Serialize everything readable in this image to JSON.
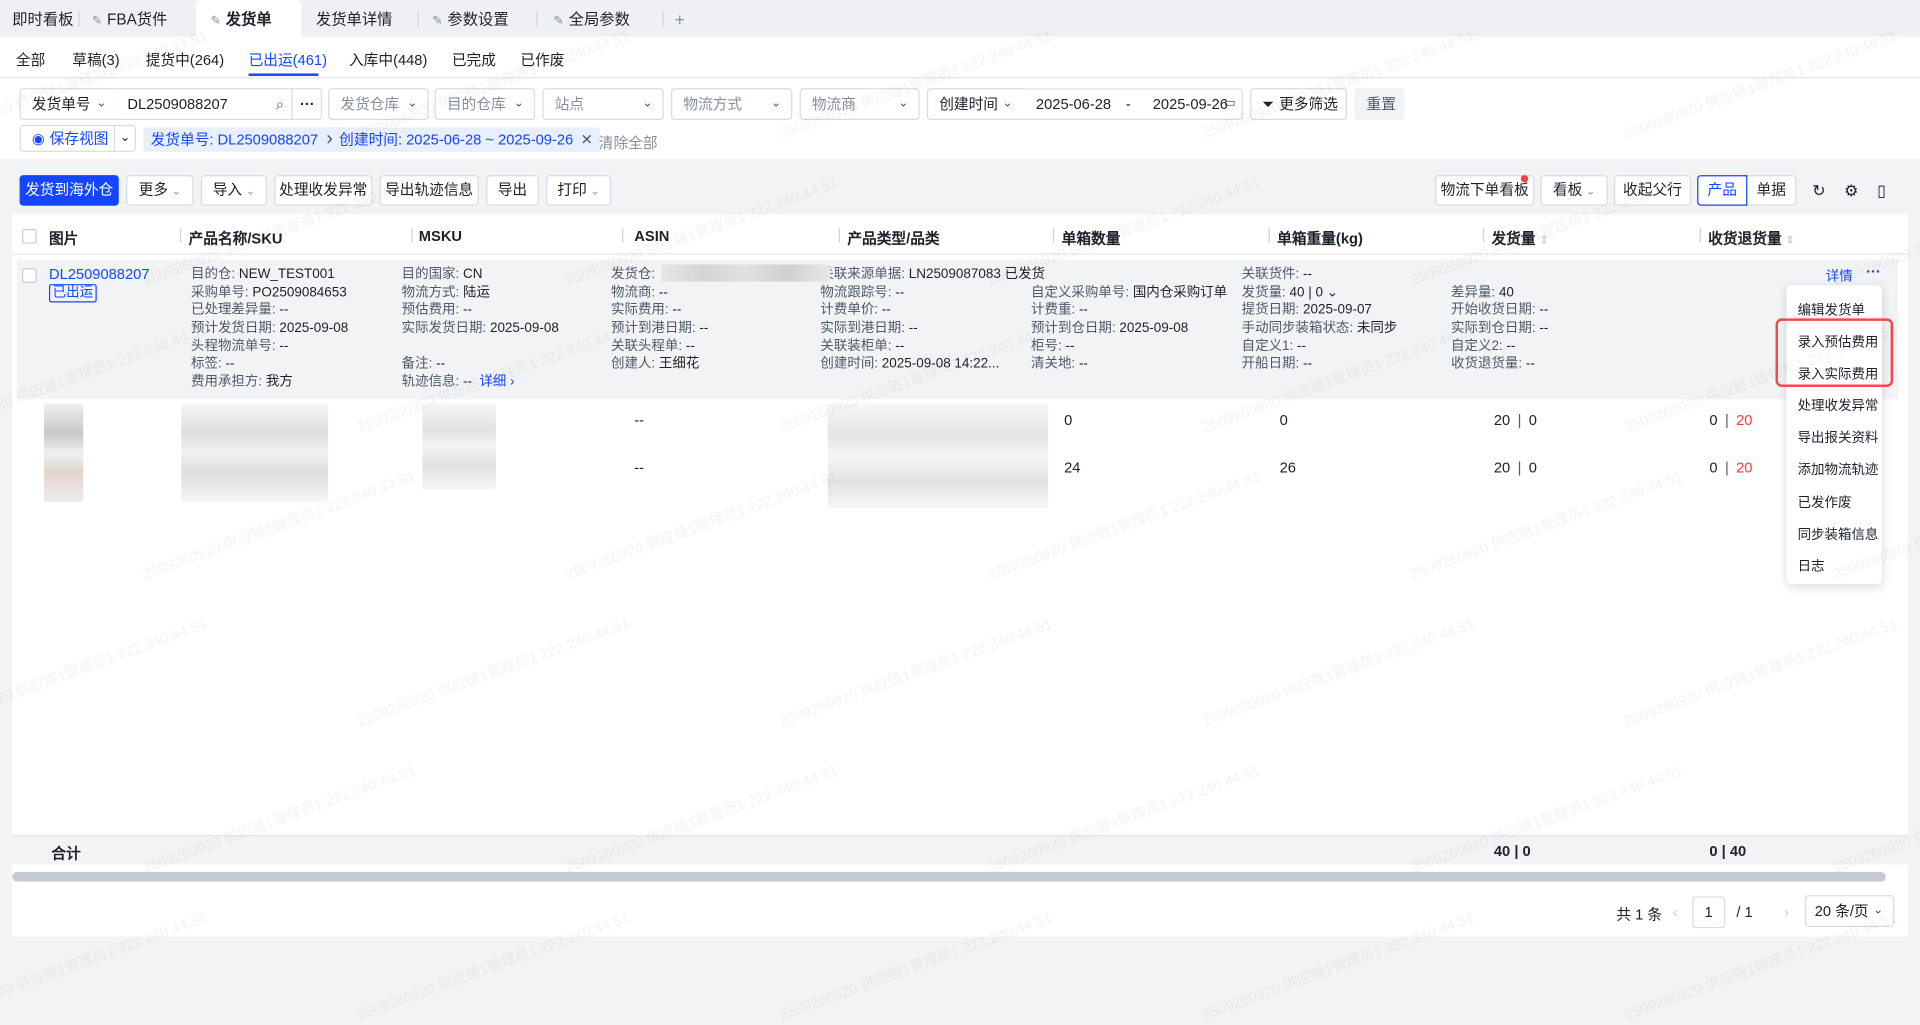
{
  "top_tabs": [
    {
      "label": "即时看板",
      "pinned": false
    },
    {
      "label": "FBA货件",
      "pinned": true
    },
    {
      "label": "发货单",
      "pinned": true,
      "active": true
    },
    {
      "label": "发货单详情",
      "pinned": false
    },
    {
      "label": "参数设置",
      "pinned": true
    },
    {
      "label": "全局参数",
      "pinned": true
    }
  ],
  "add_tab": "+",
  "status_tabs": [
    "全部",
    "草稿(3)",
    "提货中(264)",
    "已出运(461)",
    "入库中(448)",
    "已完成",
    "已作废"
  ],
  "active_status_tab": "已出运(461)",
  "filters": {
    "search_field": "发货单号",
    "search_value": "DL2509088207",
    "more_icon": "···",
    "ship_warehouse": "发货仓库",
    "dest_warehouse": "目的仓库",
    "site": "站点",
    "logistics_method": "物流方式",
    "carrier": "物流商",
    "date_field": "创建时间",
    "date_start": "2025-06-28",
    "date_sep": "-",
    "date_end": "2025-09-26",
    "more_filters": "更多筛选",
    "reset": "重置",
    "save_view": "保存视图",
    "chips": [
      "发货单号: DL2509088207",
      "创建时间: 2025-06-28 ~ 2025-09-26"
    ],
    "clear_all": "清除全部"
  },
  "toolbar": {
    "ship_overseas": "发货到海外仓",
    "more": "更多",
    "import": "导入",
    "handle_exception": "处理收发异常",
    "export_track": "导出轨迹信息",
    "export": "导出",
    "print": "打印",
    "logistics_board": "物流下单看板",
    "board": "看板",
    "collapse_parent": "收起父行",
    "view_product": "产品",
    "view_document": "单据"
  },
  "columns": [
    "图片",
    "产品名称/SKU",
    "MSKU",
    "ASIN",
    "产品类型/品类",
    "单箱数量",
    "单箱重量(kg)",
    "发货量",
    "收货退货量"
  ],
  "parent_row": {
    "order_no": "DL2509088207",
    "status": "已出运",
    "detail_link": "详情",
    "more": "···",
    "detail_columns": [
      [
        [
          "目的仓: ",
          "NEW_TEST001"
        ],
        [
          "采购单号: ",
          "PO2509084653"
        ],
        [
          "已处理差异量: ",
          "--"
        ],
        [
          "预计发货日期: ",
          "2025-09-08"
        ],
        [
          "头程物流单号: ",
          "--"
        ],
        [
          "标签: ",
          "--"
        ],
        [
          "费用承担方: ",
          "我方"
        ]
      ],
      [
        [
          "目的国家: ",
          "CN"
        ],
        [
          "物流方式: ",
          "陆运"
        ],
        [
          "预估费用: ",
          "--"
        ],
        [
          "实际发货日期: ",
          "2025-09-08"
        ],
        [
          "",
          ""
        ],
        [
          "备注: ",
          "--"
        ],
        [
          "轨迹信息: ",
          "--"
        ]
      ],
      [
        [
          "发货仓: ",
          ""
        ],
        [
          "物流商: ",
          "--"
        ],
        [
          "实际费用: ",
          "--"
        ],
        [
          "预计到港日期: ",
          "--"
        ],
        [
          "关联头程单: ",
          "--"
        ],
        [
          "创建人: ",
          "王细花"
        ]
      ],
      [
        [
          "关联来源单据: ",
          "LN2509087083 已发货"
        ],
        [
          "物流跟踪号: ",
          "--"
        ],
        [
          "计费单价: ",
          "--"
        ],
        [
          "实际到港日期: ",
          "--"
        ],
        [
          "关联装柜单: ",
          "--"
        ],
        [
          "创建时间: ",
          "2025-09-08 14:22..."
        ]
      ],
      [
        [
          "",
          ""
        ],
        [
          "自定义采购单号: ",
          "国内仓采购订单"
        ],
        [
          "计费重: ",
          "--"
        ],
        [
          "预计到仓日期: ",
          "2025-09-08"
        ],
        [
          "柜号: ",
          "--"
        ],
        [
          "清关地: ",
          "--"
        ]
      ],
      [
        [
          "关联货件: ",
          "--"
        ],
        [
          "发货量: ",
          "40 | 0 ⌄"
        ],
        [
          "提货日期: ",
          "2025-09-07"
        ],
        [
          "手动同步装箱状态: ",
          "未同步"
        ],
        [
          "自定义1: ",
          "--"
        ],
        [
          "开船日期: ",
          "--"
        ]
      ],
      [
        [
          "",
          ""
        ],
        [
          "差异量: ",
          "40"
        ],
        [
          "开始收货日期: ",
          "--"
        ],
        [
          "实际到仓日期: ",
          "--"
        ],
        [
          "自定义2: ",
          "--"
        ],
        [
          "收货退货量: ",
          "--"
        ]
      ]
    ],
    "track_detail_link": "详细 ›"
  },
  "child_rows": [
    {
      "asin": "--",
      "box_qty": "0",
      "box_weight": "0",
      "ship_qty": "20",
      "ship_qty2": "0",
      "recv_qty": "0",
      "return_qty": "20"
    },
    {
      "asin": "--",
      "box_qty": "24",
      "box_weight": "26",
      "ship_qty": "20",
      "ship_qty2": "0",
      "recv_qty": "0",
      "return_qty": "20"
    }
  ],
  "action_menu": [
    "编辑发货单",
    "录入预估费用",
    "录入实际费用",
    "处理收发异常",
    "导出报关资料",
    "添加物流轨迹",
    "已发作废",
    "同步装箱信息",
    "日志"
  ],
  "totals": {
    "label": "合计",
    "ship": "40 | 0",
    "recv_return": "0 | 40"
  },
  "pagination": {
    "total": "共 1 条",
    "prev": "‹",
    "page": "1",
    "of": "/ 1",
    "next": "›",
    "page_size": "20 条/页"
  },
  "watermark": "2509260920 供应链1管理员1 222.240.44.51",
  "colors": {
    "primary": "#1446ff",
    "danger": "#f53f3f",
    "highlight_box": "#f5484a"
  }
}
